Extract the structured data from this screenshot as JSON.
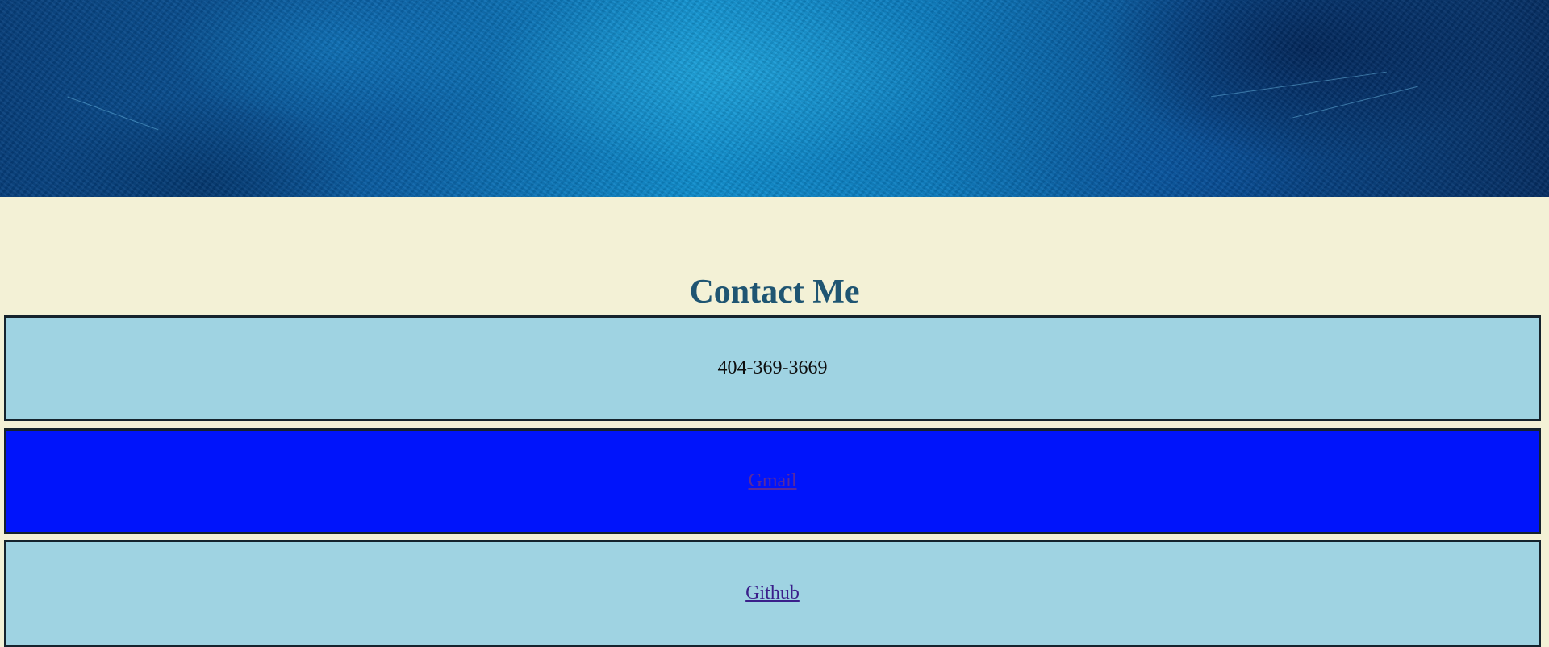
{
  "page": {
    "title": "Contact Me",
    "background_color": "#f3f1d6",
    "title_color": "#1f5572"
  },
  "hero": {
    "description": "",
    "colors": {
      "deep": "#052e63",
      "mid": "#0a5fa5",
      "light": "#0f8fcf"
    }
  },
  "contact": {
    "phone": "404-369-3669",
    "gmail_label": "Gmail",
    "github_label": "Github",
    "colors": {
      "phone_box": "#9fd3e2",
      "gmail_box": "#0014fb",
      "github_box": "#9fd3e2",
      "border": "#15232d",
      "link_visited": "#5a2a9e",
      "link": "#3a1f8a"
    }
  }
}
